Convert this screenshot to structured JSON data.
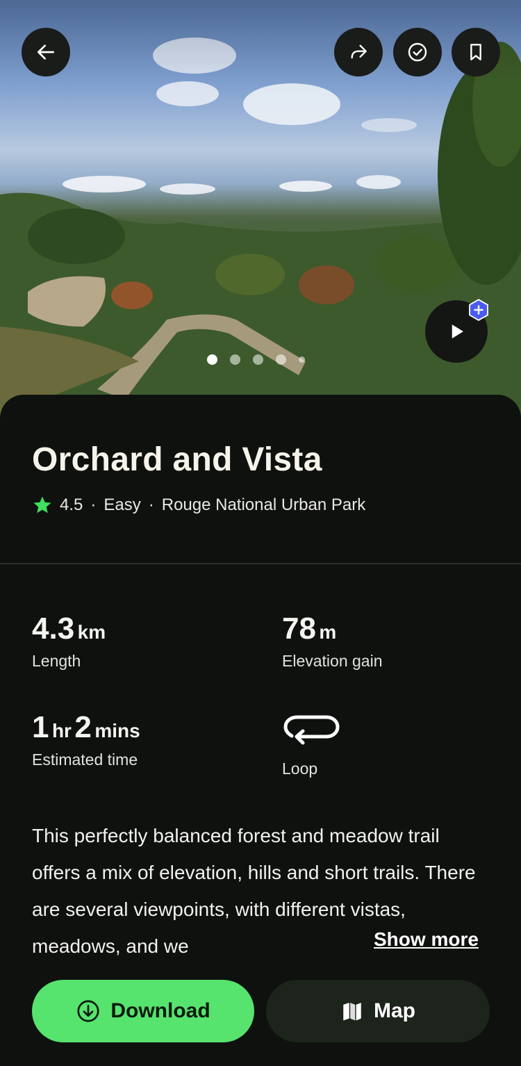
{
  "header": {
    "back_icon": "arrow-left-icon",
    "share_icon": "share-arrow-icon",
    "completed_icon": "check-circle-icon",
    "save_icon": "bookmark-icon"
  },
  "gallery": {
    "photo_count": 5,
    "active_index": 0,
    "video_icon": "play-icon",
    "video_badge_icon": "plus-hexagon-icon"
  },
  "trail": {
    "name": "Orchard and Vista",
    "rating": "4.5",
    "difficulty": "Easy",
    "park": "Rouge National Urban Park",
    "separator": "·"
  },
  "stats": {
    "length_value": "4.3",
    "length_unit": "km",
    "length_label": "Length",
    "elevation_value": "78",
    "elevation_unit": "m",
    "elevation_label": "Elevation gain",
    "time_hr_value": "1",
    "time_hr_unit": "hr",
    "time_min_value": "2",
    "time_min_unit": "mins",
    "time_label": "Estimated time",
    "route_type_label": "Loop"
  },
  "description": {
    "text": "This perfectly balanced forest and meadow trail offers a mix of elevation, hills and short trails. There are several viewpoints, with different vistas, meadows, and we",
    "show_more_label": "Show more"
  },
  "actions": {
    "download_label": "Download",
    "map_label": "Map"
  },
  "colors": {
    "accent_green": "#56e46e",
    "star_green": "#3ee05c",
    "background": "#0e110e",
    "badge_blue": "#4a5cf0"
  }
}
